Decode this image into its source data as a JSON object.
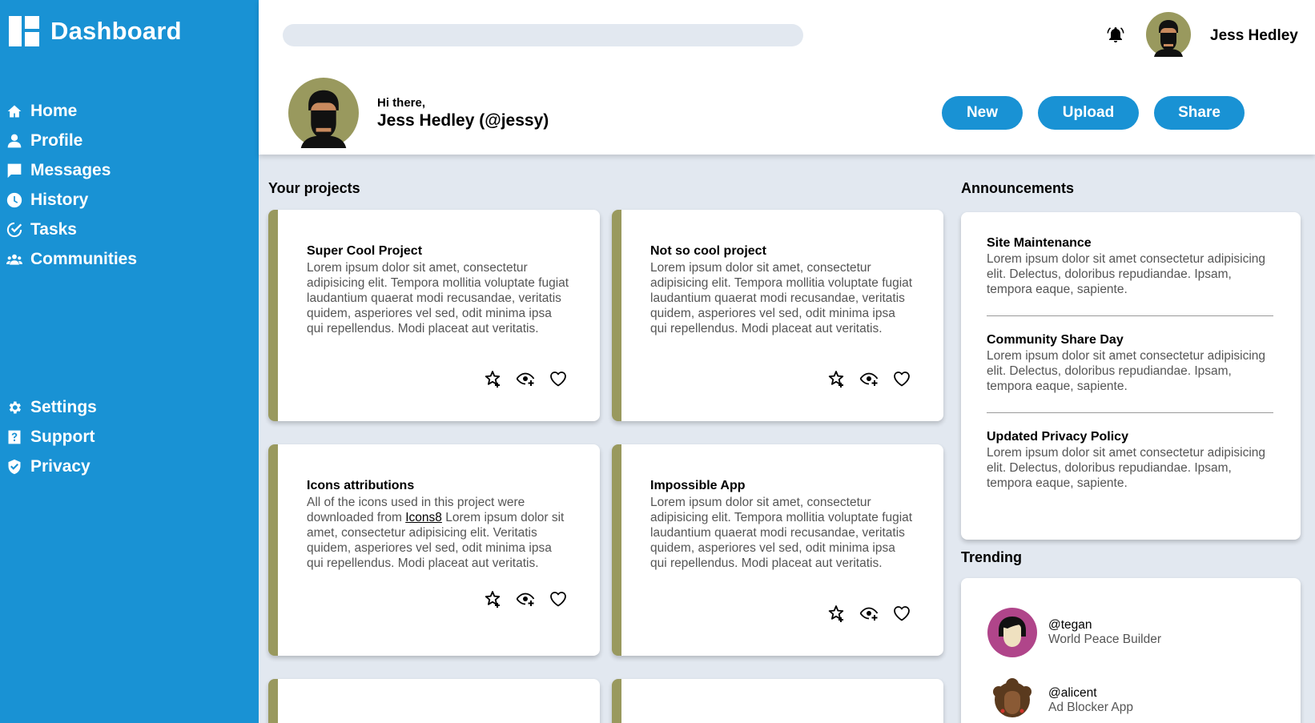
{
  "brand": {
    "title": "Dashboard",
    "icon": "dashboard-logo-icon"
  },
  "sidebar": {
    "top_items": [
      {
        "label": "Home",
        "icon": "home-icon"
      },
      {
        "label": "Profile",
        "icon": "user-icon"
      },
      {
        "label": "Messages",
        "icon": "message-icon"
      },
      {
        "label": "History",
        "icon": "clock-icon"
      },
      {
        "label": "Tasks",
        "icon": "check-circle-icon"
      },
      {
        "label": "Communities",
        "icon": "group-icon"
      }
    ],
    "bottom_items": [
      {
        "label": "Settings",
        "icon": "gear-icon"
      },
      {
        "label": "Support",
        "icon": "help-icon"
      },
      {
        "label": "Privacy",
        "icon": "shield-check-icon"
      }
    ]
  },
  "header": {
    "search_placeholder": "",
    "user_name": "Jess Hedley",
    "greeting": "Hi there,",
    "display_name": "Jess Hedley (@jessy)",
    "buttons": {
      "new": "New",
      "upload": "Upload",
      "share": "Share"
    }
  },
  "projects": {
    "heading": "Your projects",
    "items": [
      {
        "title": "Super Cool Project",
        "description": "Lorem ipsum dolor sit amet, consectetur adipisicing elit. Tempora mollitia voluptate fugiat laudantium quaerat modi recusandae, veritatis quidem, asperiores vel sed, odit minima ipsa qui repellendus. Modi placeat aut veritatis."
      },
      {
        "title": "Not so cool project",
        "description": "Lorem ipsum dolor sit amet, consectetur adipisicing elit. Tempora mollitia voluptate fugiat laudantium quaerat modi recusandae, veritatis quidem, asperiores vel sed, odit minima ipsa qui repellendus. Modi placeat aut veritatis."
      },
      {
        "title": "Icons attributions",
        "description_before": "All of the icons used in this project were downloaded from ",
        "link_text": "Icons8",
        "description_after": " Lorem ipsum dolor sit amet, consectetur adipisicing elit. Veritatis quidem, asperiores vel sed, odit minima ipsa qui repellendus. Modi placeat aut veritatis."
      },
      {
        "title": "Impossible App",
        "description": "Lorem ipsum dolor sit amet, consectetur adipisicing elit. Tempora mollitia voluptate fugiat laudantium quaerat modi recusandae, veritatis quidem, asperiores vel sed, odit minima ipsa qui repellendus. Modi placeat aut veritatis."
      }
    ],
    "card_accent": "#99995e"
  },
  "announcements": {
    "heading": "Announcements",
    "items": [
      {
        "title": "Site Maintenance",
        "body": "Lorem ipsum dolor sit amet consectetur adipisicing elit. Delectus, doloribus repudiandae. Ipsam, tempora eaque, sapiente."
      },
      {
        "title": "Community Share Day",
        "body": "Lorem ipsum dolor sit amet consectetur adipisicing elit. Delectus, doloribus repudiandae. Ipsam, tempora eaque, sapiente."
      },
      {
        "title": "Updated Privacy Policy",
        "body": "Lorem ipsum dolor sit amet consectetur adipisicing elit. Delectus, doloribus repudiandae. Ipsam, tempora eaque, sapiente."
      }
    ]
  },
  "trending": {
    "heading": "Trending",
    "items": [
      {
        "handle": "@tegan",
        "project": "World Peace Builder"
      },
      {
        "handle": "@alicent",
        "project": "Ad Blocker App"
      }
    ]
  },
  "colors": {
    "primary": "#1992d4",
    "background": "#e2e8f0",
    "accent": "#99995e"
  }
}
